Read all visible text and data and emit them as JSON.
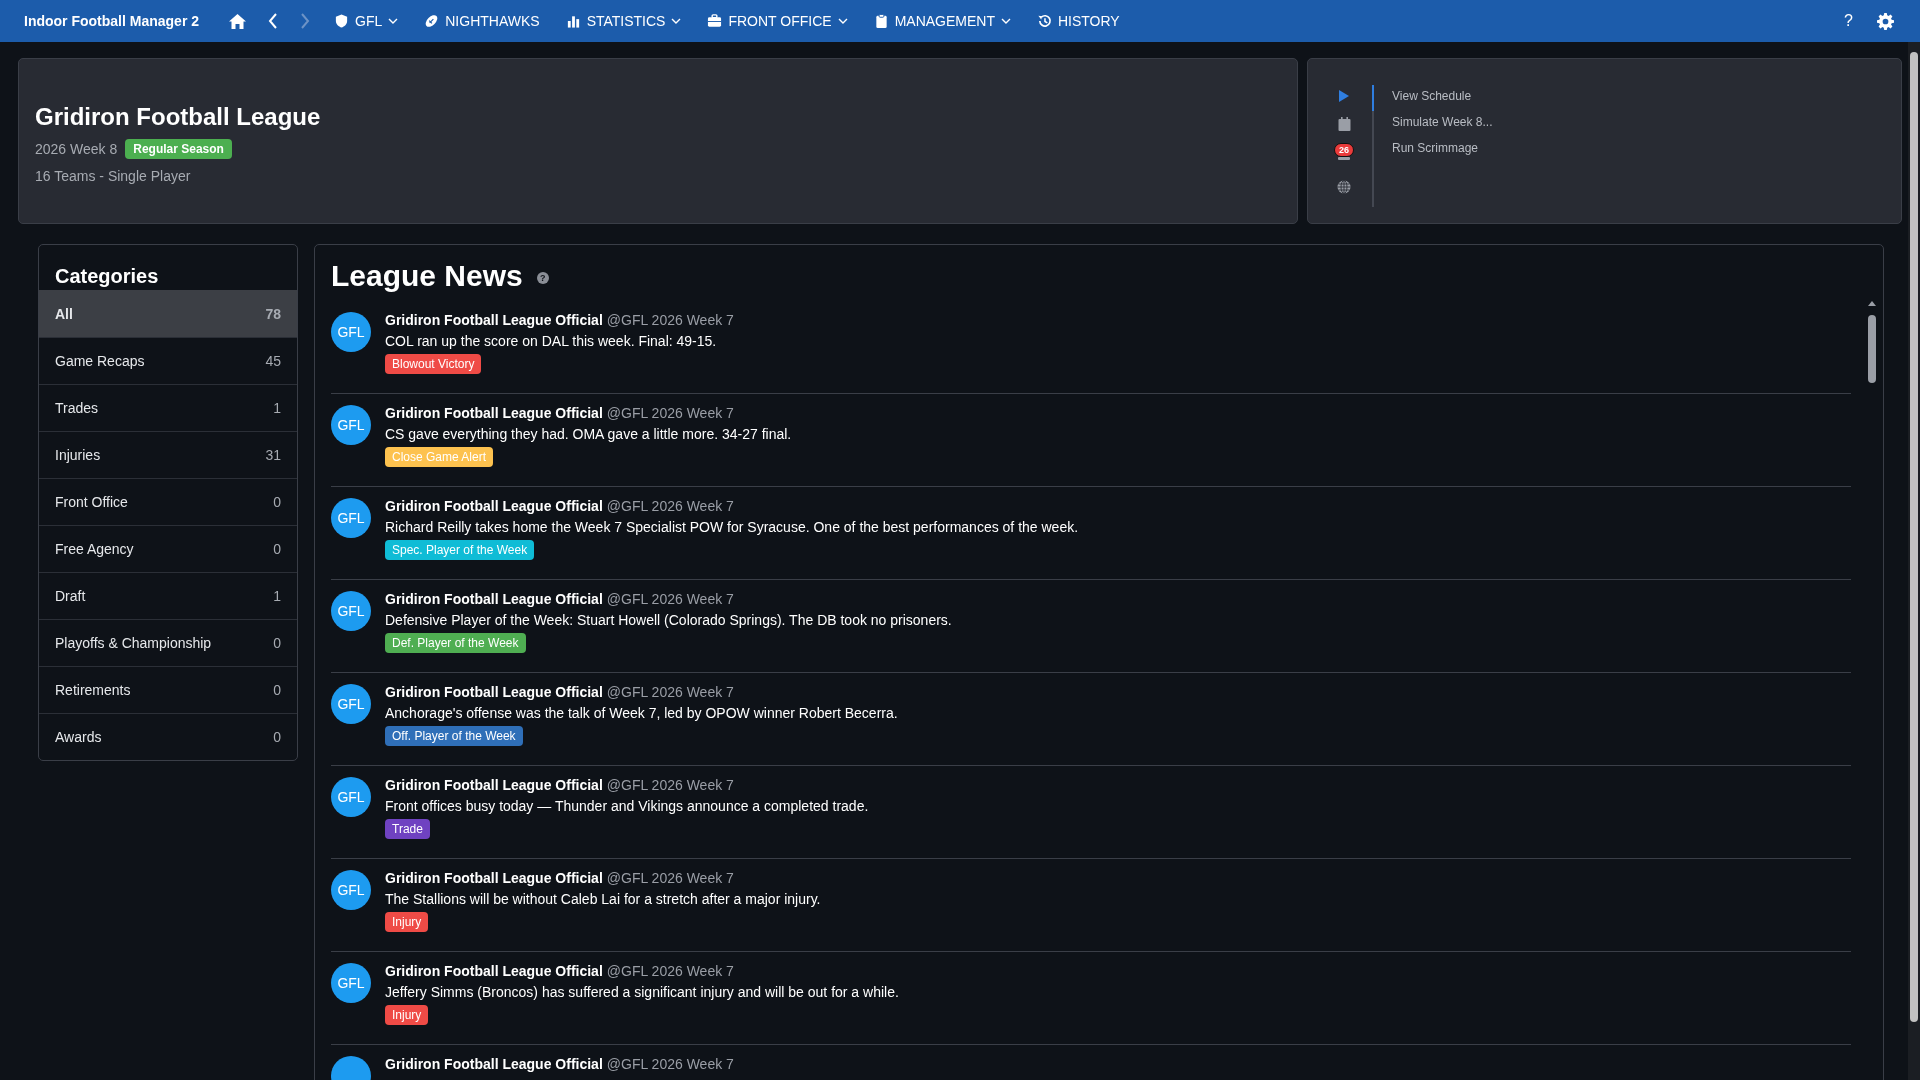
{
  "app_title": "Indoor Football Manager 2",
  "nav": [
    {
      "label": "GFL",
      "dropdown": true
    },
    {
      "label": "NIGHTHAWKS",
      "dropdown": false
    },
    {
      "label": "STATISTICS",
      "dropdown": true
    },
    {
      "label": "FRONT OFFICE",
      "dropdown": true
    },
    {
      "label": "MANAGEMENT",
      "dropdown": true
    },
    {
      "label": "HISTORY",
      "dropdown": false
    }
  ],
  "help": "?",
  "league": {
    "title": "Gridiron Football League",
    "season": "2026 Week 8",
    "phase": "Regular Season",
    "info": "16 Teams - Single Player"
  },
  "quick_actions": {
    "badge": "26",
    "items": [
      {
        "label": "View Schedule",
        "selected": true
      },
      {
        "label": "Simulate Week 8...",
        "selected": false
      },
      {
        "label": "Run Scrimmage",
        "selected": false
      }
    ]
  },
  "categories": {
    "title": "Categories",
    "items": [
      {
        "label": "All",
        "count": "78",
        "selected": true
      },
      {
        "label": "Game Recaps",
        "count": "45",
        "selected": false
      },
      {
        "label": "Trades",
        "count": "1",
        "selected": false
      },
      {
        "label": "Injuries",
        "count": "31",
        "selected": false
      },
      {
        "label": "Front Office",
        "count": "0",
        "selected": false
      },
      {
        "label": "Free Agency",
        "count": "0",
        "selected": false
      },
      {
        "label": "Draft",
        "count": "1",
        "selected": false
      },
      {
        "label": "Playoffs & Championship",
        "count": "0",
        "selected": false
      },
      {
        "label": "Retirements",
        "count": "0",
        "selected": false
      },
      {
        "label": "Awards",
        "count": "0",
        "selected": false
      }
    ]
  },
  "news": {
    "title": "League News",
    "help": "?",
    "posts": [
      {
        "avatar": "GFL",
        "author": "Gridiron Football League Official",
        "meta": "@GFL 2026 Week 7",
        "text": "COL ran up the score on DAL this week. Final: 49-15.",
        "tag": "Blowout Victory",
        "color": "#ef4b46"
      },
      {
        "avatar": "GFL",
        "author": "Gridiron Football League Official",
        "meta": "@GFL 2026 Week 7",
        "text": "CS gave everything they had. OMA gave a little more. 34-27 final.",
        "tag": "Close Game Alert",
        "color": "#fdc24f"
      },
      {
        "avatar": "GFL",
        "author": "Gridiron Football League Official",
        "meta": "@GFL 2026 Week 7",
        "text": "Richard Reilly takes home the Week 7 Specialist POW for Syracuse. One of the best performances of the week.",
        "tag": "Spec. Player of the Week",
        "color": "#0fbcd6"
      },
      {
        "avatar": "GFL",
        "author": "Gridiron Football League Official",
        "meta": "@GFL 2026 Week 7",
        "text": "Defensive Player of the Week: Stuart Howell (Colorado Springs). The DB took no prisoners.",
        "tag": "Def. Player of the Week",
        "color": "#4fae52"
      },
      {
        "avatar": "GFL",
        "author": "Gridiron Football League Official",
        "meta": "@GFL 2026 Week 7",
        "text": "Anchorage's offense was the talk of Week 7, led by OPOW winner Robert Becerra.",
        "tag": "Off. Player of the Week",
        "color": "#2f6fb8"
      },
      {
        "avatar": "GFL",
        "author": "Gridiron Football League Official",
        "meta": "@GFL 2026 Week 7",
        "text": "Front offices busy today — Thunder and Vikings announce a completed trade.",
        "tag": "Trade",
        "color": "#6f42c1"
      },
      {
        "avatar": "GFL",
        "author": "Gridiron Football League Official",
        "meta": "@GFL 2026 Week 7",
        "text": "The Stallions will be without Caleb Lai for a stretch after a major injury.",
        "tag": "Injury",
        "color": "#ef4b46"
      },
      {
        "avatar": "GFL",
        "author": "Gridiron Football League Official",
        "meta": "@GFL 2026 Week 7",
        "text": "Jeffery Simms (Broncos) has suffered a significant injury and will be out for a while.",
        "tag": "Injury",
        "color": "#ef4b46"
      },
      {
        "author": "Gridiron Football League Official",
        "meta": "@GFL 2026 Week 7"
      }
    ]
  }
}
